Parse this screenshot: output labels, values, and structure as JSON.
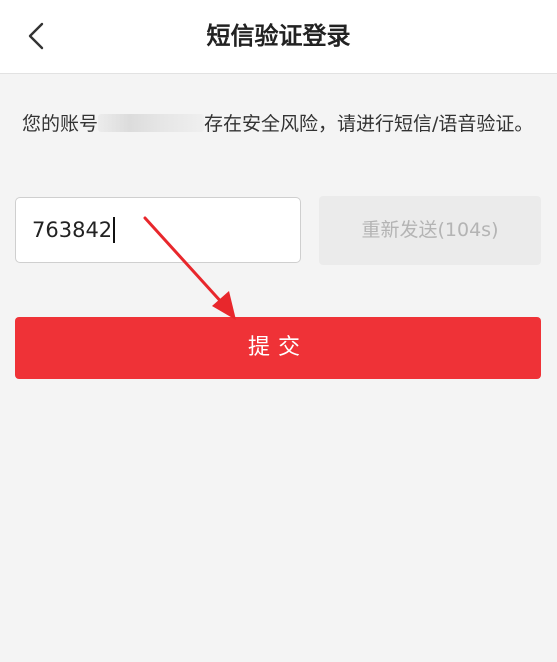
{
  "header": {
    "title": "短信验证登录",
    "back_icon": "chevron-left-icon"
  },
  "notice": {
    "prefix": "您的账号",
    "suffix": "存在安全风险，请进行短信/语音验证。"
  },
  "form": {
    "code_value": "763842",
    "resend_label": "重新发送(104s)",
    "submit_label": "提交"
  },
  "colors": {
    "primary": "#ef3237",
    "background": "#f4f4f4",
    "disabled_button": "#ebebeb",
    "disabled_text": "#b4b4b4",
    "annotation_arrow": "#e8272c"
  }
}
